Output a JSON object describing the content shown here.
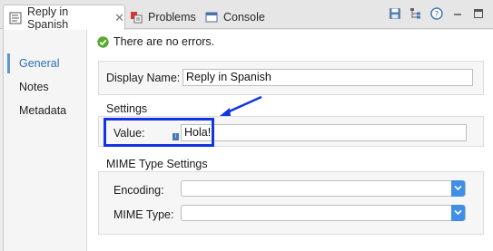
{
  "tabs": [
    {
      "label": "Reply in Spanish",
      "icon": "flow-file-icon",
      "active": true,
      "close": "✕"
    },
    {
      "label": "Problems",
      "icon": "problems-icon",
      "active": false
    },
    {
      "label": "Console",
      "icon": "console-icon",
      "active": false
    }
  ],
  "toolbar": {
    "icons": [
      "save-icon",
      "hierarchy-icon",
      "help-icon",
      "minimize-icon",
      "maximize-icon"
    ]
  },
  "nav": {
    "items": [
      {
        "label": "General",
        "selected": true
      },
      {
        "label": "Notes",
        "selected": false
      },
      {
        "label": "Metadata",
        "selected": false
      }
    ]
  },
  "status": {
    "text": "There are no errors.",
    "icon": "check-icon"
  },
  "general": {
    "display_name_label": "Display Name:",
    "display_name_value": "Reply in Spanish"
  },
  "settings": {
    "title": "Settings",
    "value_label": "Value:",
    "value": "Hola!"
  },
  "mime": {
    "title": "MIME Type Settings",
    "encoding_label": "Encoding:",
    "encoding_value": "",
    "mime_type_label": "MIME Type:",
    "mime_type_value": ""
  },
  "colors": {
    "highlight": "#1335e0",
    "accent": "#3f8fe6",
    "nav_selected": "#2e6fb3"
  }
}
